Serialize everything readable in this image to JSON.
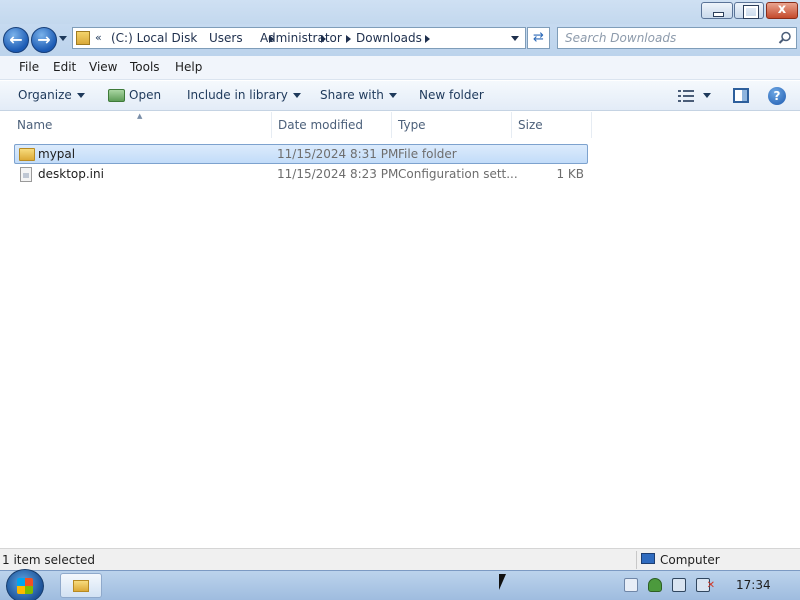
{
  "window": {
    "close_glyph": "x"
  },
  "address": {
    "overflow": "«",
    "crumbs": [
      "(C:) Local Disk",
      "Users",
      "Administrator",
      "Downloads"
    ]
  },
  "search": {
    "placeholder": "Search Downloads"
  },
  "menu": {
    "items": [
      "File",
      "Edit",
      "View",
      "Tools",
      "Help"
    ]
  },
  "toolbar": {
    "organize": "Organize",
    "open": "Open",
    "include_in_library": "Include in library",
    "share_with": "Share with",
    "new_folder": "New folder",
    "help": "?"
  },
  "columns": {
    "name": "Name",
    "date_modified": "Date modified",
    "type": "Type",
    "size": "Size"
  },
  "files": [
    {
      "name": "mypal",
      "date": "11/15/2024 8:31 PM",
      "type": "File folder",
      "size": "",
      "icon": "folder-icon",
      "selected": true
    },
    {
      "name": "desktop.ini",
      "date": "11/15/2024 8:23 PM",
      "type": "Configuration sett...",
      "size": "1 KB",
      "icon": "config-file-icon",
      "selected": false
    }
  ],
  "status": {
    "selection": "1 item selected",
    "location": "Computer"
  },
  "taskbar": {
    "clock": "17:34"
  },
  "colors": {
    "selection_bg": "#cfe3fb",
    "selection_border": "#7da2ce",
    "chrome_blue": "#c3d8ee"
  }
}
